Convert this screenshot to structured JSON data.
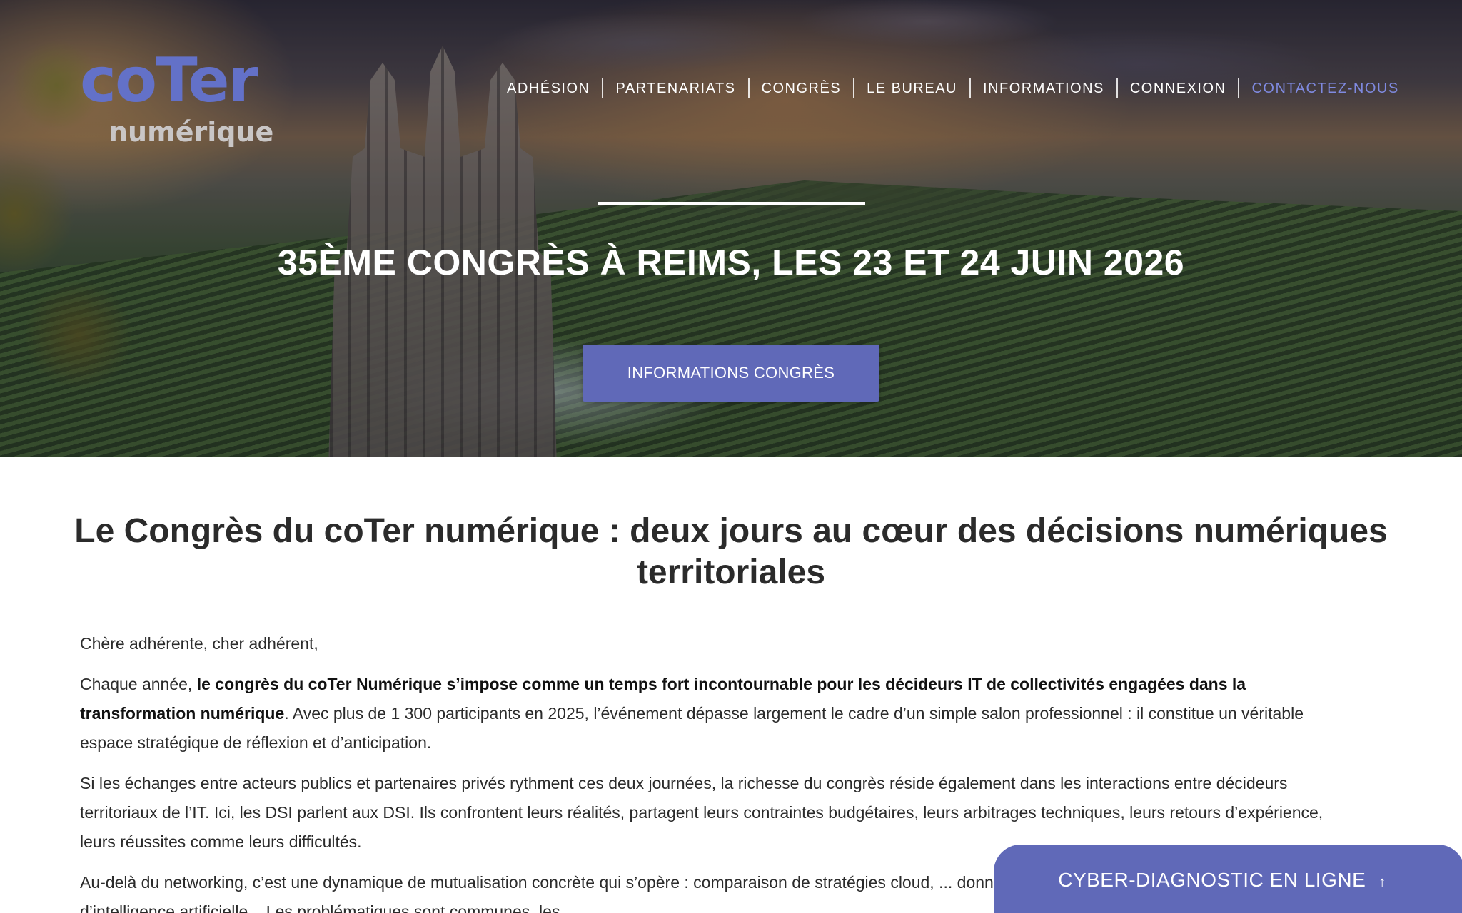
{
  "logo": {
    "main": "coTer",
    "sub": "numérique"
  },
  "nav": {
    "items": [
      {
        "label": "ADHÉSION"
      },
      {
        "label": "PARTENARIATS"
      },
      {
        "label": "CONGRÈS"
      },
      {
        "label": "LE BUREAU"
      },
      {
        "label": "INFORMATIONS"
      },
      {
        "label": "CONNEXION"
      },
      {
        "label": "CONTACTEZ-NOUS"
      }
    ]
  },
  "hero": {
    "title": "35ÈME CONGRÈS À REIMS, LES 23 ET 24 JUIN 2026",
    "button_label": "INFORMATIONS CONGRÈS"
  },
  "article": {
    "title": "Le Congrès du coTer numérique : deux jours au cœur des décisions numériques territoriales",
    "greeting": "Chère adhérente, cher adhérent,",
    "p1_start": "Chaque année, ",
    "p1_bold": "le congrès du coTer Numérique s’impose comme un temps fort incontournable pour les décideurs IT de collectivités engagées dans la transformation numérique",
    "p1_end": ". Avec plus de 1 300 participants en 2025, l’événement dépasse largement le cadre d’un simple salon professionnel : il constitue un véritable espace stratégique de réflexion et d’anticipation.",
    "p2": "Si les échanges entre acteurs publics et partenaires privés rythment ces deux journées, la richesse du congrès réside également dans les interactions entre décideurs territoriaux de l’IT. Ici, les DSI parlent aux DSI. Ils confrontent leurs réalités, partagent leurs contraintes budgétaires, leurs arbitrages techniques, leurs retours d’expérience, leurs réussites comme leurs difficultés.",
    "p3": "Au-delà du networking, c’est une dynamique de mutualisation concrète qui s’opère : comparaison de stratégies cloud, ... donnée, choix d’architectures, pilotage de projets d’intelligence artificielle... Les problématiques sont communes, les..."
  },
  "cta": {
    "label": "CYBER-DIAGNOSTIC EN LIGNE",
    "icon": "arrow-up-icon"
  },
  "colors": {
    "accent": "#6069b8",
    "nav_accent": "#7f8ae0",
    "logo": "#6371c8"
  }
}
